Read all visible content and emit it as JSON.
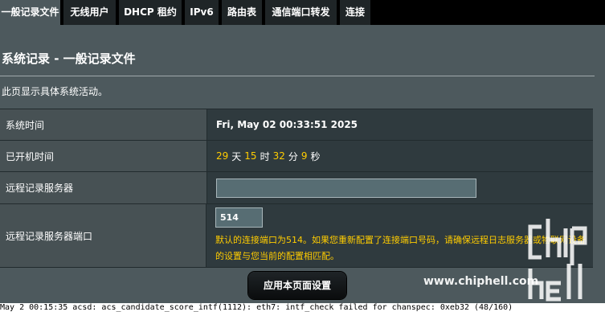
{
  "tabs": [
    {
      "label": "一般记录文件",
      "active": true
    },
    {
      "label": "无线用户"
    },
    {
      "label": "DHCP 租约"
    },
    {
      "label": "IPv6"
    },
    {
      "label": "路由表"
    },
    {
      "label": "通信端口转发"
    },
    {
      "label": "连接"
    }
  ],
  "page": {
    "title": "系统记录 - 一般记录文件",
    "description": "此页显示具体系统活动。"
  },
  "rows": {
    "system_time": {
      "label": "系统时间",
      "value": "Fri, May 02 00:33:51 2025"
    },
    "uptime": {
      "label": "已开机时间",
      "days": "29",
      "days_unit": "天",
      "hours": "15",
      "hours_unit": "时",
      "minutes": "32",
      "minutes_unit": "分",
      "seconds": "9",
      "seconds_unit": "秒"
    },
    "remote_log_server": {
      "label": "远程记录服务器",
      "value": ""
    },
    "remote_log_port": {
      "label": "远程记录服务器端口",
      "value": "514",
      "hint": "默认的连接端口为514。如果您重新配置了连接端口号码，请确保远程日志服务器或物联网设备的设置与您当前的配置相匹配。"
    }
  },
  "apply_label": "应用本页面设置",
  "log_line": "May  2 00:15:35 acsd: acs_candidate_score_intf(1112): eth7: intf_check failed for chanspec: 0xeb32 (48/160)",
  "watermark": {
    "url": "www.chiphell.com",
    "logo": "chiphell-logo"
  },
  "colors": {
    "background": "#4d595d",
    "accent": "#ffcc00",
    "tabbar": "#000000"
  }
}
